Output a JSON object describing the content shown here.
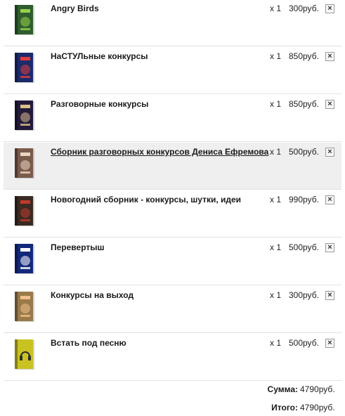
{
  "items": [
    {
      "title": "Angry Birds",
      "qty": "x 1",
      "price": "300руб.",
      "cover": {
        "main": "#2e5e2e",
        "accent": "#9ad14b",
        "icon": "dvd-box-icon"
      },
      "remove_label": "×"
    },
    {
      "title": "НаСТУЛьные конкурсы",
      "qty": "x 1",
      "price": "850руб.",
      "cover": {
        "main": "#1b2a6b",
        "accent": "#e23b3b",
        "icon": "dvd-box-icon"
      },
      "remove_label": "×"
    },
    {
      "title": "Разговорные конкурсы",
      "qty": "x 1",
      "price": "850руб.",
      "cover": {
        "main": "#241a3a",
        "accent": "#d9c08a",
        "icon": "dvd-box-icon"
      },
      "remove_label": "×"
    },
    {
      "title": "Сборник разговорных конкурсов Дениса Ефремова",
      "qty": "x 1",
      "price": "500руб.",
      "cover": {
        "main": "#7a5a4a",
        "accent": "#e9d6c2",
        "icon": "dvd-box-icon"
      },
      "remove_label": "×"
    },
    {
      "title": "Новогодний сборник - конкурсы, шутки, идеи",
      "qty": "x 1",
      "price": "990руб.",
      "cover": {
        "main": "#3a2a22",
        "accent": "#c0392b",
        "icon": "dvd-box-icon"
      },
      "remove_label": "×"
    },
    {
      "title": "Перевертыш",
      "qty": "x 1",
      "price": "500руб.",
      "cover": {
        "main": "#13287a",
        "accent": "#ffffff",
        "icon": "dvd-box-icon"
      },
      "remove_label": "×"
    },
    {
      "title": "Конкурсы на выход",
      "qty": "x 1",
      "price": "300руб.",
      "cover": {
        "main": "#9a7a4a",
        "accent": "#f0c08a",
        "icon": "dvd-box-icon"
      },
      "remove_label": "×"
    },
    {
      "title": "Встать под песню",
      "qty": "x 1",
      "price": "500руб.",
      "cover": {
        "main": "#c9c223",
        "accent": "#2e2e2e",
        "icon": "headphones-icon"
      },
      "remove_label": "×"
    }
  ],
  "totals": {
    "sum_label": "Сумма:",
    "sum_value": "4790руб.",
    "total_label": "Итого:",
    "total_value": "4790руб."
  }
}
